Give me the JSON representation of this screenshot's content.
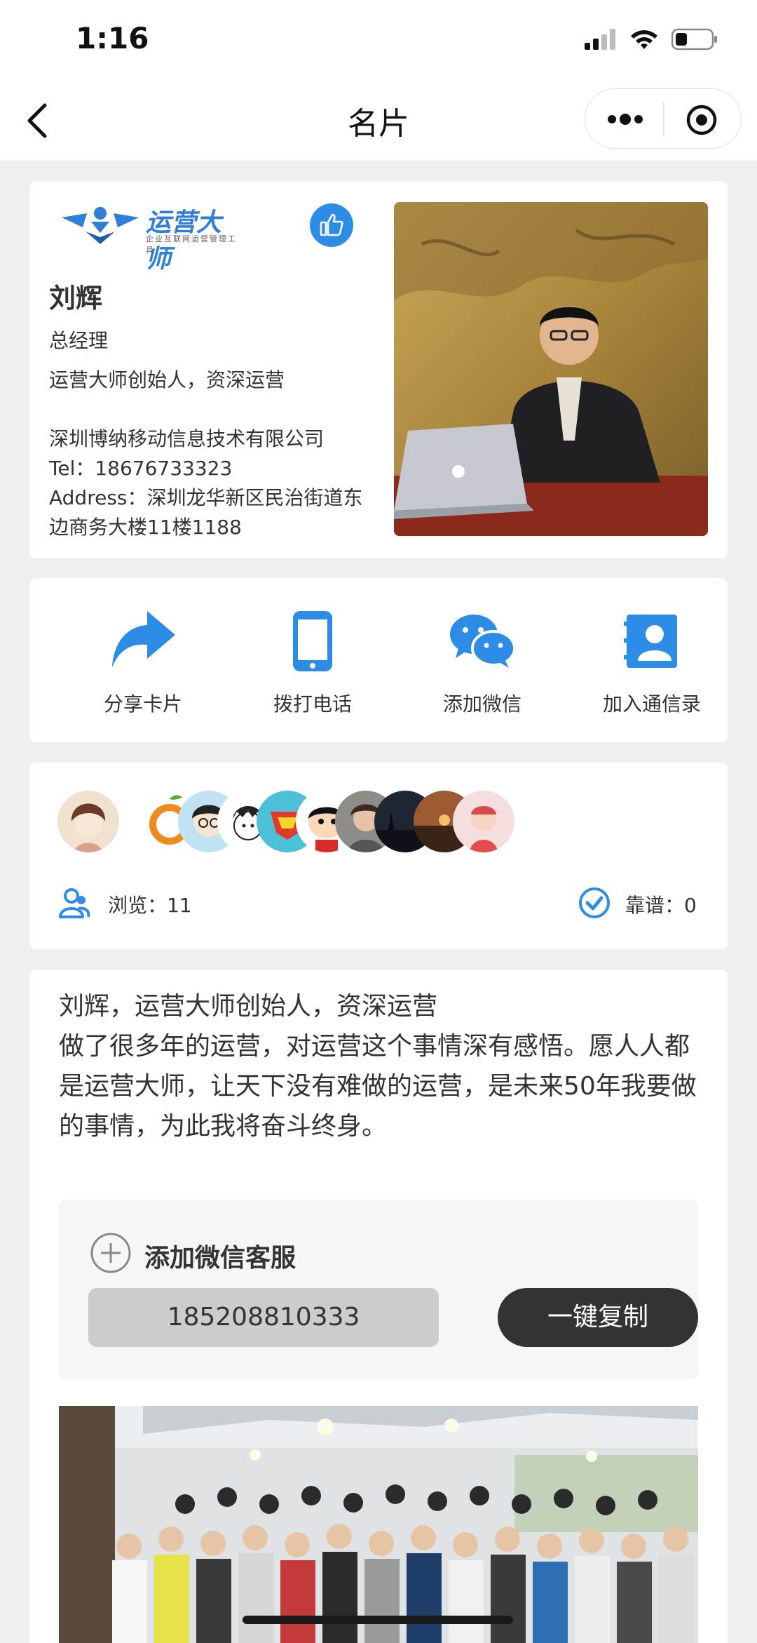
{
  "status": {
    "time": "1:16"
  },
  "nav": {
    "title": "名片"
  },
  "profile": {
    "logo_text": "运营大师",
    "logo_sub": "企业互联网运营管理工具",
    "name": "刘辉",
    "position": "总经理",
    "tagline": "运营大师创始人，资深运营",
    "company": "深圳博纳移动信息技术有限公司",
    "tel": "Tel：18676733323",
    "address_line1": "Address：深圳龙华新区民治街道东",
    "address_line2": "边商务大楼11楼1188"
  },
  "actions": [
    {
      "label": "分享卡片",
      "icon": "share-icon"
    },
    {
      "label": "拨打电话",
      "icon": "phone-icon"
    },
    {
      "label": "添加微信",
      "icon": "wechat-icon"
    },
    {
      "label": "加入通信录",
      "icon": "contacts-icon"
    }
  ],
  "stats": {
    "views": "浏览：11",
    "reliable": "靠谱：0"
  },
  "intro": {
    "line1": "刘辉，运营大师创始人，资深运营",
    "line2": "做了很多年的运营，对运营这个事情深有感悟。愿人人都是运营大师，让天下没有难做的运营，是未来50年我要做的事情，为此我将奋斗终身。"
  },
  "wechat": {
    "title": "添加微信客服",
    "number": "185208810333",
    "copy_label": "一键复制"
  },
  "colors": {
    "accent": "#2d8de6",
    "background": "#efefef",
    "button_dark": "#333333"
  }
}
